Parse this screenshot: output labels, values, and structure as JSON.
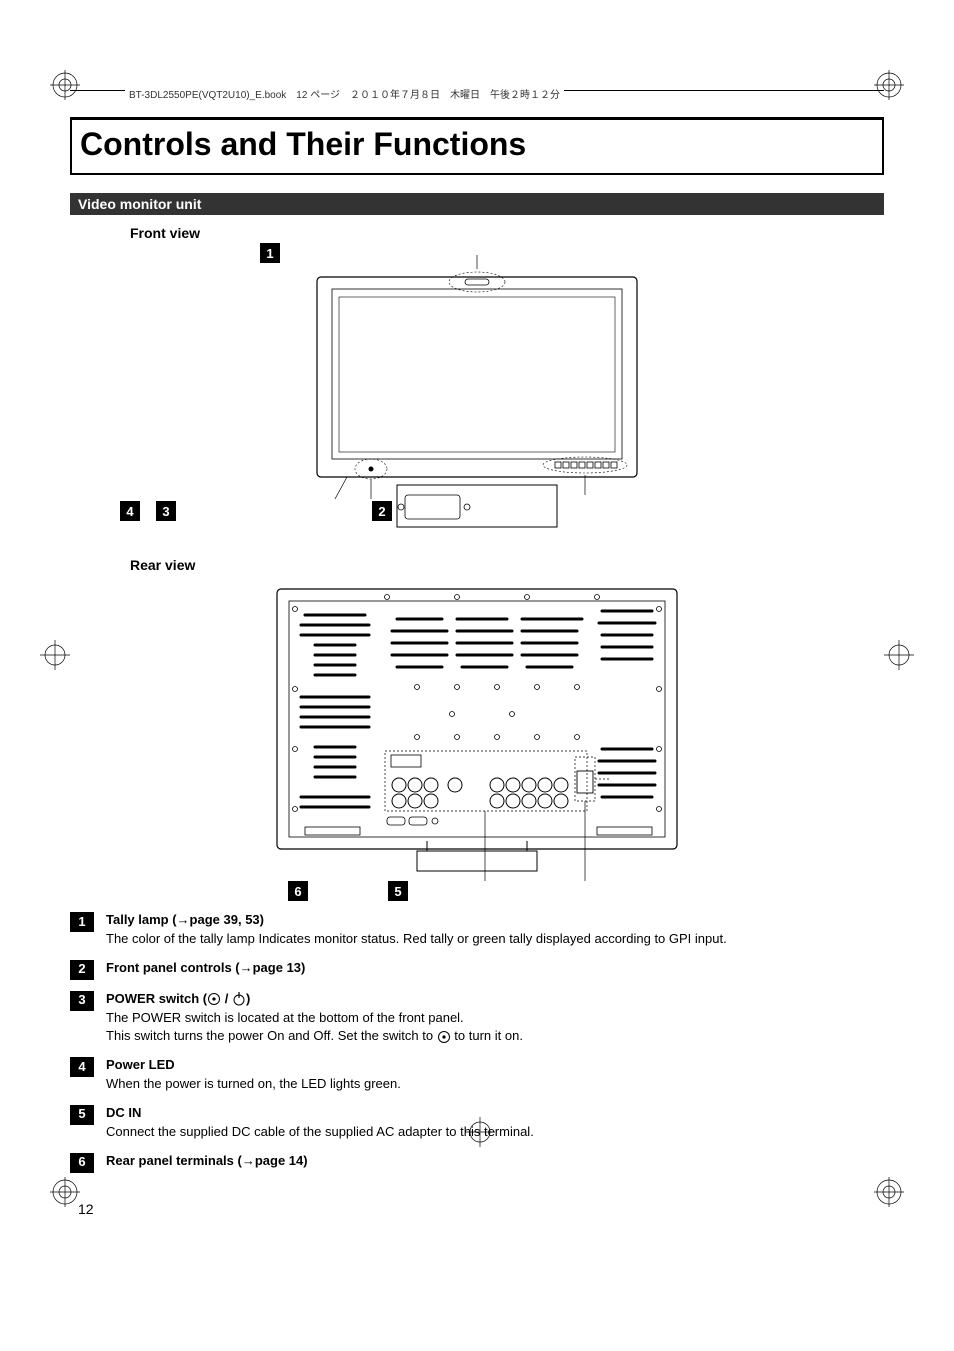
{
  "header": {
    "running": "BT-3DL2550PE(VQT2U10)_E.book　12 ページ　２０１０年７月８日　木曜日　午後２時１２分"
  },
  "title": "Controls and Their Functions",
  "section_bar": "Video monitor unit",
  "front_view_label": "Front view",
  "rear_view_label": "Rear view",
  "callouts": {
    "c1": "1",
    "c2": "2",
    "c3": "3",
    "c4": "4",
    "c5": "5",
    "c6": "6"
  },
  "items": [
    {
      "num": "1",
      "head": "Tally lamp (→page 39, 53)",
      "lines": [
        "The color of the tally lamp Indicates monitor status. Red tally or green tally displayed according to GPI input."
      ]
    },
    {
      "num": "2",
      "head": "Front panel controls (→page 13)",
      "lines": []
    },
    {
      "num": "3",
      "head_prefix": "POWER switch (",
      "head_suffix": ")",
      "lines": [
        "The POWER switch is located at the bottom of the front panel.",
        "This switch turns the power On and Off. Set the switch to __ICON_ON__ to turn it on."
      ]
    },
    {
      "num": "4",
      "head": "Power LED",
      "lines": [
        "When the power is turned on, the LED lights green."
      ]
    },
    {
      "num": "5",
      "head": "DC IN",
      "lines": [
        "Connect the supplied DC cable of the supplied AC adapter to this terminal."
      ]
    },
    {
      "num": "6",
      "head": "Rear panel terminals (→page 14)",
      "lines": []
    }
  ],
  "page_number": "12"
}
